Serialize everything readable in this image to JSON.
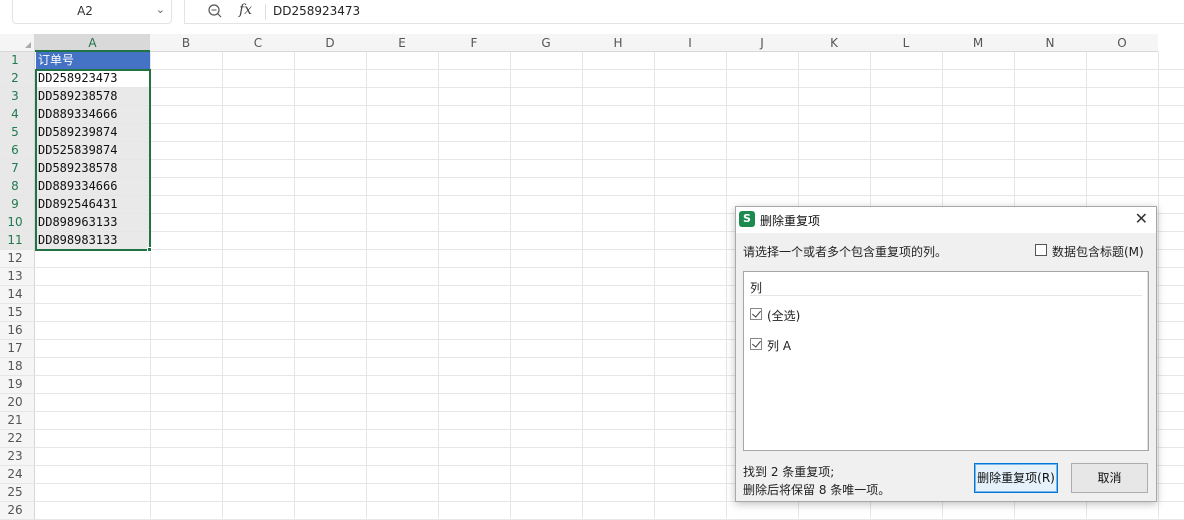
{
  "formula_bar": {
    "name_box": "A2",
    "formula": "DD258923473"
  },
  "columns": [
    "A",
    "B",
    "C",
    "D",
    "E",
    "F",
    "G",
    "H",
    "I",
    "J",
    "K",
    "L",
    "M",
    "N",
    "O"
  ],
  "rows": [
    "1",
    "2",
    "3",
    "4",
    "5",
    "6",
    "7",
    "8",
    "9",
    "10",
    "11",
    "12",
    "13",
    "14",
    "15",
    "16",
    "17",
    "18",
    "19",
    "20",
    "21",
    "22",
    "23",
    "24",
    "25",
    "26"
  ],
  "cells": {
    "A1": "订单号",
    "A2": "DD258923473",
    "A3": "DD589238578",
    "A4": "DD889334666",
    "A5": "DD589239874",
    "A6": "DD525839874",
    "A7": "DD589238578",
    "A8": "DD889334666",
    "A9": "DD892546431",
    "A10": "DD898963133",
    "A11": "DD898983133"
  },
  "colors": {
    "header_fill": "#4472c4",
    "selection_border": "#217346",
    "app_logo": "#1d8a4f"
  },
  "dialog": {
    "logo": "S",
    "title": "删除重复项",
    "prompt": "请选择一个或者多个包含重复项的列。",
    "header_checkbox_label": "数据包含标题(M)",
    "header_checkbox_checked": false,
    "list_header": "列",
    "items": [
      {
        "label": "(全选)",
        "checked": true
      },
      {
        "label": "列 A",
        "checked": true
      }
    ],
    "status_line1": "找到 2 条重复项;",
    "status_line2": "删除后将保留 8 条唯一项。",
    "delete_button": "删除重复项(R)",
    "cancel_button": "取消"
  }
}
